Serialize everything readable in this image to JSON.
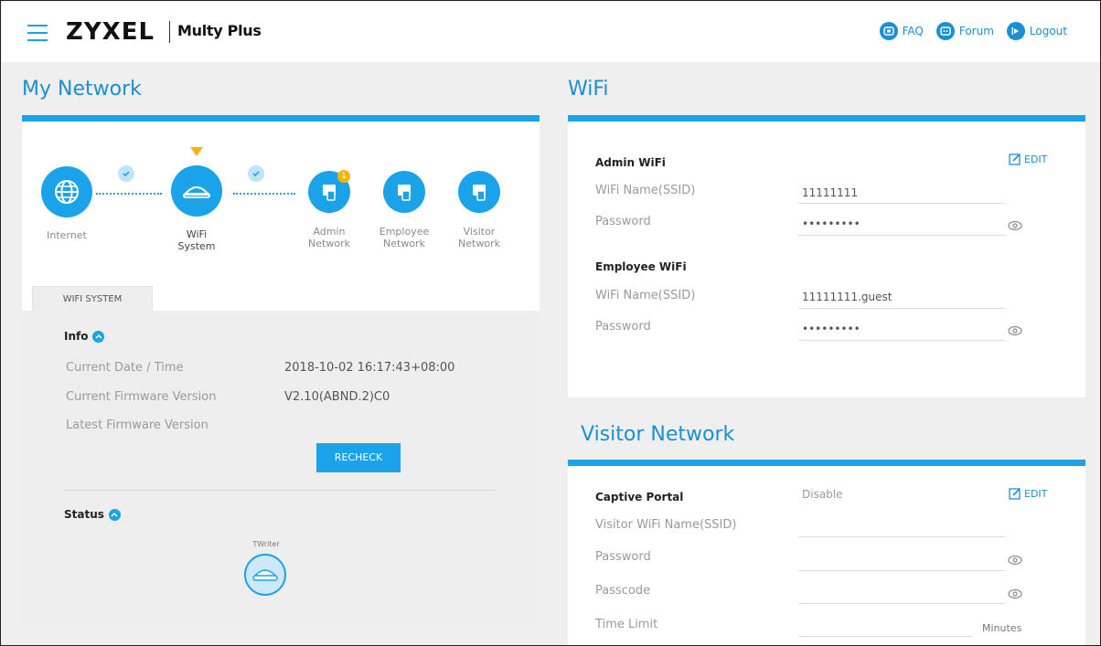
{
  "header": {
    "brand": "ZYXEL",
    "product": "Multy Plus",
    "links": [
      {
        "label": "FAQ",
        "icon": "faq-icon"
      },
      {
        "label": "Forum",
        "icon": "forum-icon"
      },
      {
        "label": "Logout",
        "icon": "logout-icon"
      }
    ]
  },
  "my_network": {
    "title": "My Network",
    "nodes": [
      {
        "line1": "Internet",
        "line2": ""
      },
      {
        "line1": "WiFi",
        "line2": "System"
      },
      {
        "line1": "Admin",
        "line2": "Network",
        "badge": "1"
      },
      {
        "line1": "Employee",
        "line2": "Network"
      },
      {
        "line1": "Visitor",
        "line2": "Network"
      }
    ],
    "tab": "WIFI SYSTEM",
    "info": {
      "heading": "Info",
      "rows": [
        {
          "label": "Current Date / Time",
          "value": "2018-10-02 16:17:43+08:00"
        },
        {
          "label": "Current Firmware Version",
          "value": "V2.10(ABND.2)C0"
        },
        {
          "label": "Latest Firmware Version",
          "value": ""
        }
      ],
      "recheck": "RECHECK"
    },
    "status": {
      "heading": "Status",
      "device_name": "TWriter"
    }
  },
  "wifi": {
    "title": "WiFi",
    "edit_label": "EDIT",
    "admin": {
      "heading": "Admin WiFi",
      "ssid_label": "WiFi Name(SSID)",
      "ssid_value": "11111111",
      "password_label": "Password",
      "password_value": "•••••••••"
    },
    "employee": {
      "heading": "Employee WiFi",
      "ssid_label": "WiFi Name(SSID)",
      "ssid_value": "11111111.guest",
      "password_label": "Password",
      "password_value": "•••••••••"
    }
  },
  "visitor": {
    "title": "Visitor Network",
    "edit_label": "EDIT",
    "captive_label": "Captive Portal",
    "captive_value": "Disable",
    "ssid_label": "Visitor WiFi Name(SSID)",
    "password_label": "Password",
    "passcode_label": "Passcode",
    "time_limit_label": "Time Limit",
    "time_unit": "Minutes"
  },
  "colors": {
    "accent": "#1aa3e8",
    "link": "#1a8fd6",
    "badge": "#f4b400",
    "panel_bg": "#eeeeee"
  }
}
